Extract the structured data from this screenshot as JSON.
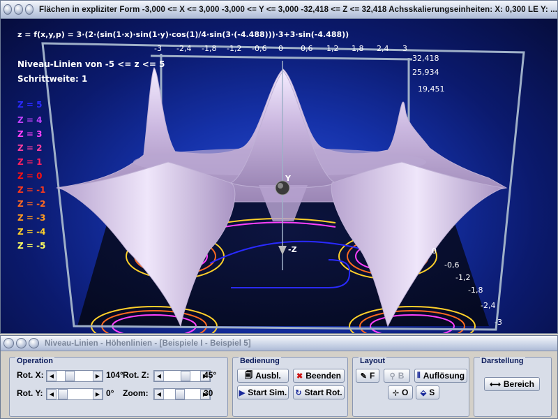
{
  "main_window": {
    "title": "Flächen in expliziter Form   -3,000 <= X <= 3,000   -3,000 <= Y <= 3,000   -32,418 <= Z <= 32,418   Achsskalierungseinheiten:  X: 0,300 LE    Y: ...",
    "formula": "z = f(x,y,p) = 3·(2·(sin(1·x)·sin(1·y)·cos(1)/4·sin(3·(-4.488)))·3+3·sin(-4.488))",
    "niveau_line": "Niveau-Linien von -5 <= z <= 5",
    "step_line": "Schrittweite: 1",
    "legend": [
      {
        "label": "Z = 5",
        "color": "#2a2aff"
      },
      {
        "label": "Z = 4",
        "color": "#c040ff"
      },
      {
        "label": "Z = 3",
        "color": "#ff40ff"
      },
      {
        "label": "Z = 2",
        "color": "#ff3ea0"
      },
      {
        "label": "Z = 1",
        "color": "#ff2060"
      },
      {
        "label": "Z = 0",
        "color": "#ff1010"
      },
      {
        "label": "Z = -1",
        "color": "#ff3a1a"
      },
      {
        "label": "Z = -2",
        "color": "#ff6a20"
      },
      {
        "label": "Z = -3",
        "color": "#ff9a20"
      },
      {
        "label": "Z = -4",
        "color": "#ffd02a"
      },
      {
        "label": "Z = -5",
        "color": "#ffff60"
      }
    ],
    "x_ticks": [
      "-3",
      "-2,4",
      "-1,8",
      "-1,2",
      "-0,6",
      "0",
      "0,6",
      "1,2",
      "1,8",
      "2,4",
      "3"
    ],
    "z_ticks": [
      "32,418",
      "25,934",
      "19,451"
    ],
    "y_ticks": [
      "0",
      "-0,6",
      "-1,2",
      "-1,8",
      "-2,4",
      "-3"
    ],
    "axis_y_label": "Y",
    "axis_z_label": "-Z"
  },
  "panel_window": {
    "title": "Niveau-Linien - Höhenlinien - [Beispiele I - Beispiel 5]",
    "operation": {
      "label": "Operation",
      "rot_x_label": "Rot. X:",
      "rot_x_value": "104°",
      "rot_y_label": "Rot. Y:",
      "rot_y_value": "0°",
      "rot_z_label": "Rot. Z:",
      "rot_z_value": "45°",
      "zoom_label": "Zoom:",
      "zoom_value": "30"
    },
    "bedienung": {
      "label": "Bedienung",
      "ausbl": "Ausbl.",
      "beenden": "Beenden",
      "start_sim": "Start Sim.",
      "start_rot": "Start Rot."
    },
    "layout": {
      "label": "Layout",
      "f": "F",
      "b": "B",
      "aufloesung": "Auflösung",
      "o": "O",
      "s": "S"
    },
    "darstellung": {
      "label": "Darstellung",
      "bereich": "Bereich"
    }
  }
}
